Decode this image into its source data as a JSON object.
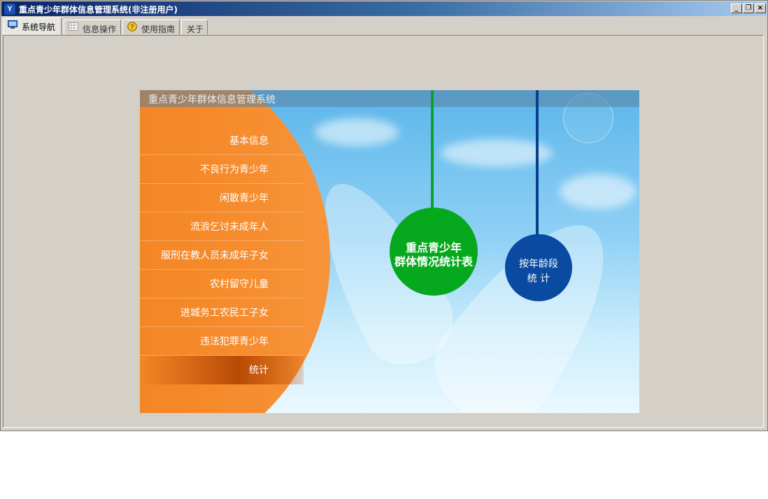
{
  "window": {
    "title": "重点青少年群体信息管理系统(非注册用户)",
    "icon": "app-logo-icon",
    "controls": [
      "minimize",
      "restore",
      "close"
    ]
  },
  "tabs": [
    {
      "label": "系统导航",
      "icon": "monitor-icon",
      "active": true
    },
    {
      "label": "信息操作",
      "icon": "grid-icon",
      "active": false
    },
    {
      "label": "使用指南",
      "icon": "help-icon",
      "active": false
    },
    {
      "label": "关于",
      "icon": "",
      "active": false
    }
  ],
  "panel": {
    "banner": "重点青少年群体信息管理系统",
    "menu": [
      "基本信息",
      "不良行为青少年",
      "闲散青少年",
      "流浪乞讨未成年人",
      "服刑在教人员未成年子女",
      "农村留守儿童",
      "进城务工农民工子女",
      "违法犯罪青少年",
      "统计"
    ],
    "bubbles": [
      {
        "line1": "重点青少年",
        "line2": "群体情况统计表",
        "color": "#06a81e"
      },
      {
        "line1": "按年龄段",
        "line2": "统 计",
        "color": "#0a4aa0"
      }
    ]
  },
  "colors": {
    "menu_orange": "#f5852a",
    "sky_blue": "#6cc2f0",
    "titlebar": "#0a246a"
  }
}
